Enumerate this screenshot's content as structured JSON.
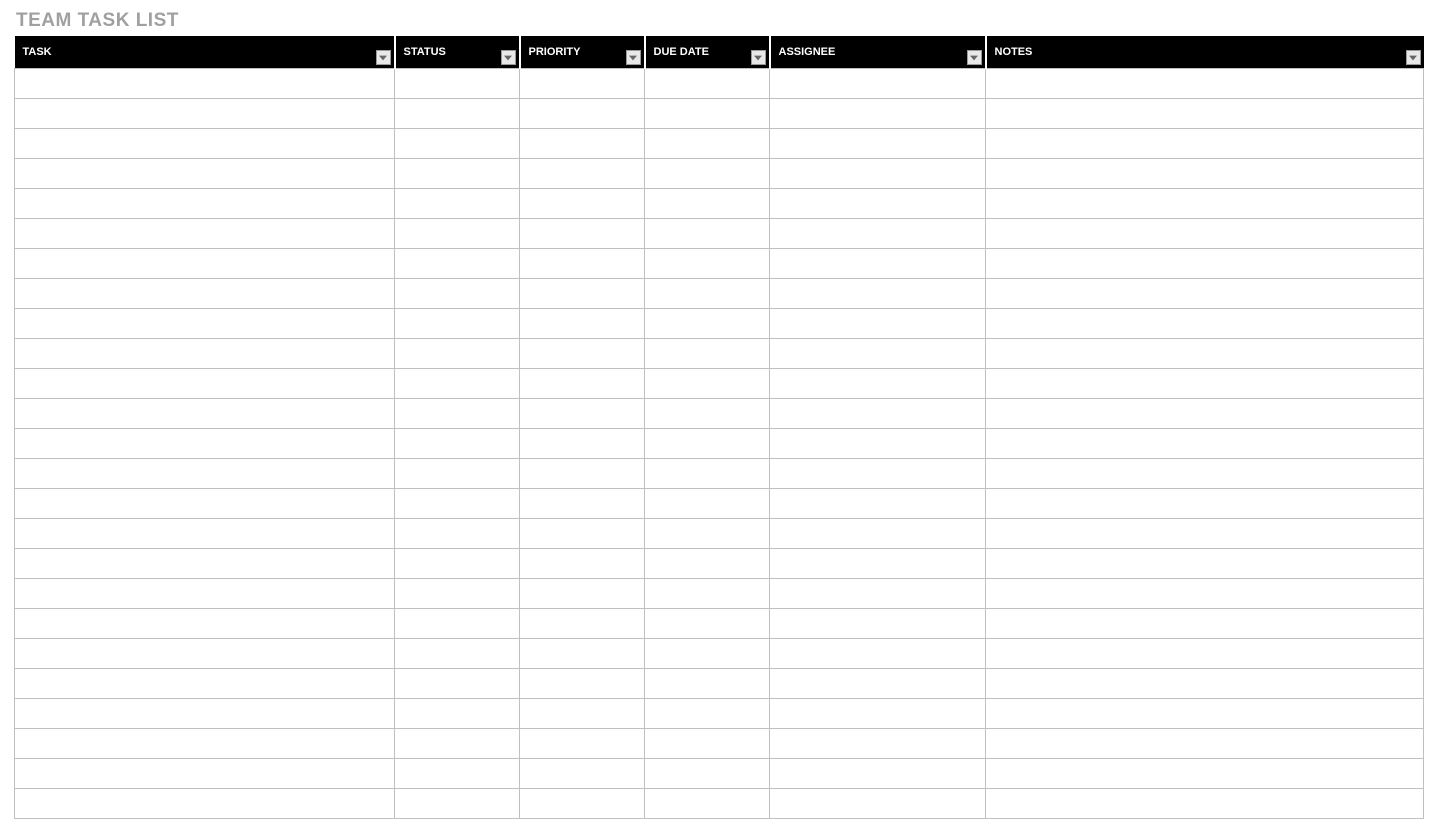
{
  "title": "TEAM TASK LIST",
  "columns": [
    {
      "label": "TASK",
      "key": "task"
    },
    {
      "label": "STATUS",
      "key": "status"
    },
    {
      "label": "PRIORITY",
      "key": "priority"
    },
    {
      "label": "DUE DATE",
      "key": "duedate"
    },
    {
      "label": "ASSIGNEE",
      "key": "assignee"
    },
    {
      "label": "NOTES",
      "key": "notes"
    }
  ],
  "rows": [
    {
      "task": "",
      "status": "",
      "priority": "",
      "duedate": "",
      "assignee": "",
      "notes": ""
    },
    {
      "task": "",
      "status": "",
      "priority": "",
      "duedate": "",
      "assignee": "",
      "notes": ""
    },
    {
      "task": "",
      "status": "",
      "priority": "",
      "duedate": "",
      "assignee": "",
      "notes": ""
    },
    {
      "task": "",
      "status": "",
      "priority": "",
      "duedate": "",
      "assignee": "",
      "notes": ""
    },
    {
      "task": "",
      "status": "",
      "priority": "",
      "duedate": "",
      "assignee": "",
      "notes": ""
    },
    {
      "task": "",
      "status": "",
      "priority": "",
      "duedate": "",
      "assignee": "",
      "notes": ""
    },
    {
      "task": "",
      "status": "",
      "priority": "",
      "duedate": "",
      "assignee": "",
      "notes": ""
    },
    {
      "task": "",
      "status": "",
      "priority": "",
      "duedate": "",
      "assignee": "",
      "notes": ""
    },
    {
      "task": "",
      "status": "",
      "priority": "",
      "duedate": "",
      "assignee": "",
      "notes": ""
    },
    {
      "task": "",
      "status": "",
      "priority": "",
      "duedate": "",
      "assignee": "",
      "notes": ""
    },
    {
      "task": "",
      "status": "",
      "priority": "",
      "duedate": "",
      "assignee": "",
      "notes": ""
    },
    {
      "task": "",
      "status": "",
      "priority": "",
      "duedate": "",
      "assignee": "",
      "notes": ""
    },
    {
      "task": "",
      "status": "",
      "priority": "",
      "duedate": "",
      "assignee": "",
      "notes": ""
    },
    {
      "task": "",
      "status": "",
      "priority": "",
      "duedate": "",
      "assignee": "",
      "notes": ""
    },
    {
      "task": "",
      "status": "",
      "priority": "",
      "duedate": "",
      "assignee": "",
      "notes": ""
    },
    {
      "task": "",
      "status": "",
      "priority": "",
      "duedate": "",
      "assignee": "",
      "notes": ""
    },
    {
      "task": "",
      "status": "",
      "priority": "",
      "duedate": "",
      "assignee": "",
      "notes": ""
    },
    {
      "task": "",
      "status": "",
      "priority": "",
      "duedate": "",
      "assignee": "",
      "notes": ""
    },
    {
      "task": "",
      "status": "",
      "priority": "",
      "duedate": "",
      "assignee": "",
      "notes": ""
    },
    {
      "task": "",
      "status": "",
      "priority": "",
      "duedate": "",
      "assignee": "",
      "notes": ""
    },
    {
      "task": "",
      "status": "",
      "priority": "",
      "duedate": "",
      "assignee": "",
      "notes": ""
    },
    {
      "task": "",
      "status": "",
      "priority": "",
      "duedate": "",
      "assignee": "",
      "notes": ""
    },
    {
      "task": "",
      "status": "",
      "priority": "",
      "duedate": "",
      "assignee": "",
      "notes": ""
    },
    {
      "task": "",
      "status": "",
      "priority": "",
      "duedate": "",
      "assignee": "",
      "notes": ""
    },
    {
      "task": "",
      "status": "",
      "priority": "",
      "duedate": "",
      "assignee": "",
      "notes": ""
    }
  ]
}
